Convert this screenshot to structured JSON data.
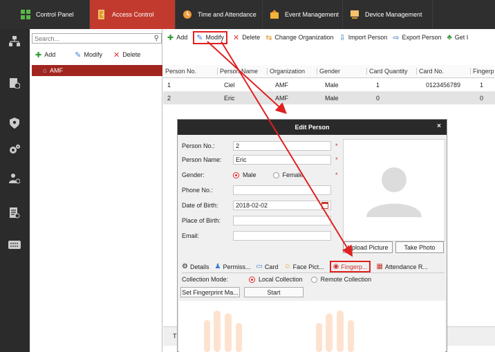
{
  "top_tabs": [
    {
      "label": "Control Panel"
    },
    {
      "label": "Access Control"
    },
    {
      "label": "Time and Attendance"
    },
    {
      "label": "Event Management"
    },
    {
      "label": "Device Management"
    }
  ],
  "left_panel": {
    "search_placeholder": "Search...",
    "add_label": "Add",
    "modify_label": "Modify",
    "delete_label": "Delete",
    "tree_root": "AMF"
  },
  "main_toolbar": {
    "add": "Add",
    "modify": "Modify",
    "delete": "Delete",
    "change_org": "Change Organization",
    "import_person": "Import Person",
    "export_person": "Export Person",
    "get": "Get I"
  },
  "table": {
    "headers": [
      "Person No.",
      "Person Name",
      "Organization",
      "Gender",
      "Card Quantity",
      "Card No.",
      "Fingerp"
    ],
    "rows": [
      [
        "1",
        "Ciel",
        "AMF",
        "Male",
        "1",
        "0123456789",
        "1"
      ],
      [
        "2",
        "Eric",
        "AMF",
        "Male",
        "0",
        "",
        "0"
      ]
    ]
  },
  "bottom_strip_letter": "T",
  "dialog": {
    "title": "Edit Person",
    "close": "×",
    "fields": {
      "person_no_label": "Person No.:",
      "person_no_value": "2",
      "person_name_label": "Person Name:",
      "person_name_value": "Eric",
      "gender_label": "Gender:",
      "gender_male": "Male",
      "gender_female": "Female",
      "phone_label": "Phone No.:",
      "dob_label": "Date of Birth:",
      "dob_value": "2018-02-02",
      "pob_label": "Place of Birth:",
      "email_label": "Email:",
      "required_mark": "*"
    },
    "upload_picture": "Upload Picture",
    "take_photo": "Take Photo",
    "tabs": [
      "Details",
      "Permiss...",
      "Card",
      "Face Pict...",
      "Fingerp...",
      "Attendance R..."
    ],
    "collection_mode_label": "Collection Mode:",
    "local_collection": "Local Collection",
    "remote_collection": "Remote Collection",
    "set_fingerprint": "Set Fingerprint Ma...",
    "start": "Start"
  },
  "colors": {
    "accent_red": "#c23a2e",
    "highlight_red": "#e02020",
    "dark_bar": "#2f2f2f",
    "fingerprint_hand": "#fde3cf"
  }
}
